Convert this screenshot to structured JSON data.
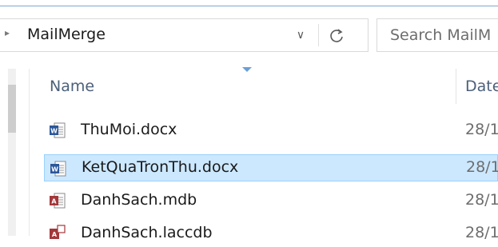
{
  "address": {
    "path": "MailMerge",
    "dropdown_glyph": "∨"
  },
  "search": {
    "placeholder": "Search MailM"
  },
  "columns": {
    "name": "Name",
    "date": "Date"
  },
  "files": [
    {
      "name": "ThuMoi.docx",
      "date": "28/1",
      "icon": "word-doc-icon",
      "selected": false
    },
    {
      "name": "KetQuaTronThu.docx",
      "date": "28/1",
      "icon": "word-doc-icon",
      "selected": true
    },
    {
      "name": "DanhSach.mdb",
      "date": "28/1",
      "icon": "access-db-icon",
      "selected": false
    },
    {
      "name": "DanhSach.laccdb",
      "date": "28/1",
      "icon": "access-lock-icon",
      "selected": false
    }
  ],
  "colors": {
    "selection_bg": "#cce8ff",
    "selection_border": "#99d1ff",
    "word_blue": "#2b579a",
    "access_red": "#a4373a",
    "header_text": "#4c607a"
  }
}
